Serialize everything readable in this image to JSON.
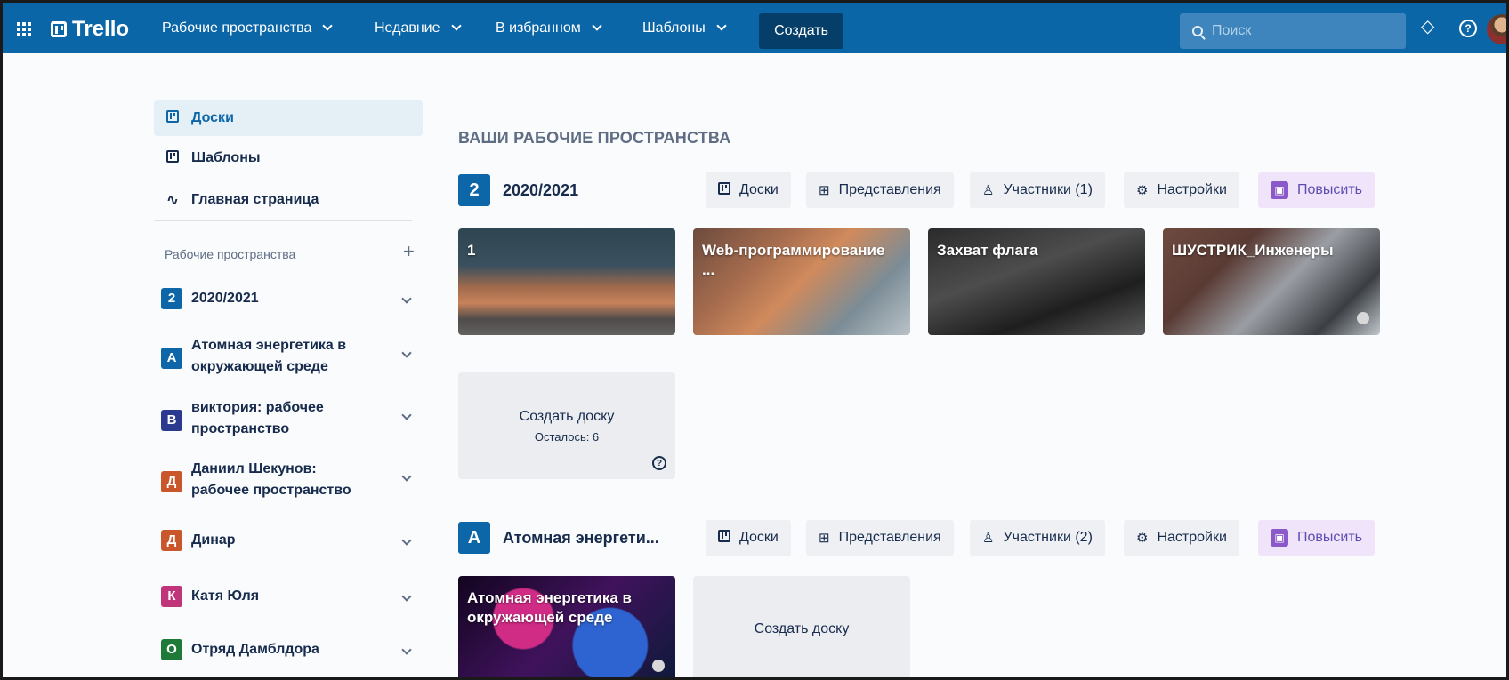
{
  "header": {
    "logo": "Trello",
    "nav": [
      {
        "label": "Рабочие пространства"
      },
      {
        "label": "Недавние"
      },
      {
        "label": "В избранном"
      },
      {
        "label": "Шаблоны"
      }
    ],
    "create_label": "Создать",
    "search_placeholder": "Поиск"
  },
  "sidebar": {
    "items": [
      {
        "label": "Доски",
        "icon": "board-icon"
      },
      {
        "label": "Шаблоны",
        "icon": "template-icon"
      },
      {
        "label": "Главная страница",
        "icon": "activity-icon"
      }
    ],
    "workspaces_label": "Рабочие пространства",
    "workspaces": [
      {
        "letter": "2",
        "name": "2020/2021",
        "color": "#0c66a8"
      },
      {
        "letter": "А",
        "name": "Атомная энергетика в окружающей среде",
        "color": "#0c66a8"
      },
      {
        "letter": "В",
        "name": "виктория: рабочее пространство",
        "color": "#2b3a8f"
      },
      {
        "letter": "Д",
        "name": "Даниил Шекунов: рабочее пространство",
        "color": "#c9572b"
      },
      {
        "letter": "Д",
        "name": "Динар",
        "color": "#c9572b"
      },
      {
        "letter": "К",
        "name": "Катя Юля",
        "color": "#c0347a"
      },
      {
        "letter": "О",
        "name": "Отряд Дамблдора",
        "color": "#1f7a3a"
      }
    ]
  },
  "main": {
    "title": "ВАШИ РАБОЧИЕ ПРОСТРАНСТВА",
    "workspaces": [
      {
        "letter": "2",
        "name": "2020/2021",
        "color": "#0c66a8",
        "buttons": [
          "Доски",
          "Представления",
          "Участники (1)",
          "Настройки",
          "Повысить"
        ],
        "boards": [
          "1",
          "Web-программирование ...",
          "Захват флага",
          "ШУСТРИК_Инженеры"
        ],
        "create_label": "Создать доску",
        "remaining": "Осталось: 6"
      },
      {
        "letter": "А",
        "name": "Атомная энергети...",
        "color": "#0c66a8",
        "buttons": [
          "Доски",
          "Представления",
          "Участники (2)",
          "Настройки",
          "Повысить"
        ],
        "boards": [
          "Атомная энергетика в окружающей среде"
        ],
        "create_label": "Создать доску"
      }
    ]
  }
}
